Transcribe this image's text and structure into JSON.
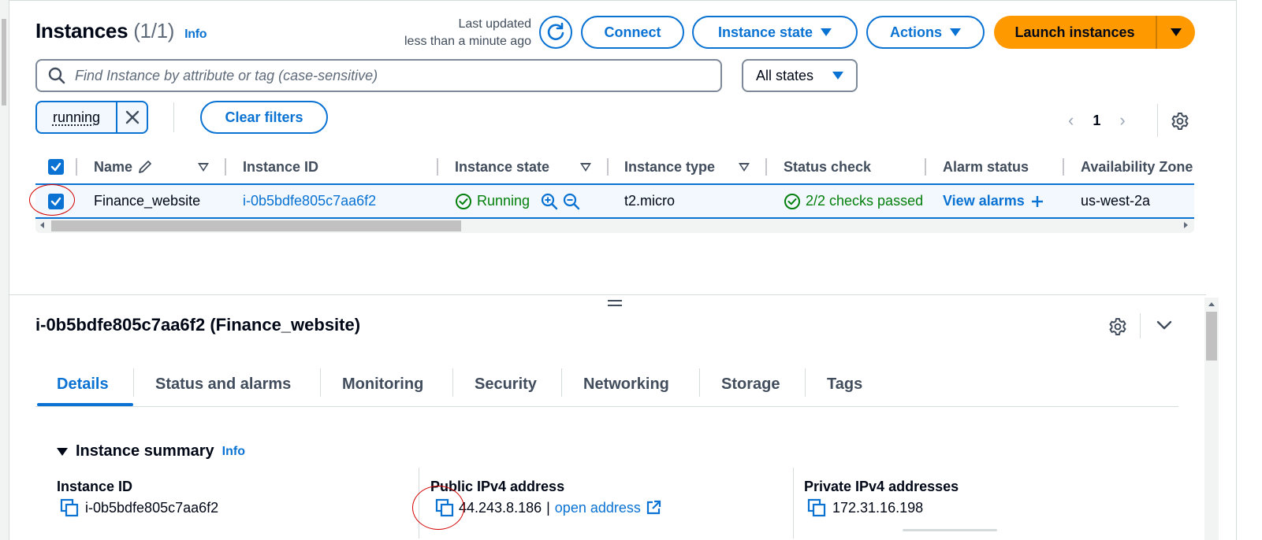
{
  "header": {
    "title": "Instances",
    "count": "(1/1)",
    "info": "Info",
    "last_updated_line1": "Last updated",
    "last_updated_line2": "less than a minute ago",
    "connect": "Connect",
    "instance_state": "Instance state",
    "actions": "Actions",
    "launch": "Launch instances"
  },
  "search": {
    "placeholder": "Find Instance by attribute or tag (case-sensitive)",
    "state_filter": "All states"
  },
  "filters": {
    "token": "running",
    "clear": "Clear filters"
  },
  "pagination": {
    "page": "1"
  },
  "table": {
    "columns": [
      "Name",
      "Instance ID",
      "Instance state",
      "Instance type",
      "Status check",
      "Alarm status",
      "Availability Zone"
    ],
    "row": {
      "name": "Finance_website",
      "instance_id": "i-0b5bdfe805c7aa6f2",
      "state": "Running",
      "type": "t2.micro",
      "status_check": "2/2 checks passed",
      "alarm": "View alarms",
      "az": "us-west-2a"
    }
  },
  "details": {
    "title": "i-0b5bdfe805c7aa6f2 (Finance_website)",
    "tabs": [
      "Details",
      "Status and alarms",
      "Monitoring",
      "Security",
      "Networking",
      "Storage",
      "Tags"
    ],
    "summary_title": "Instance summary",
    "summary_info": "Info",
    "fields": {
      "instance_id_label": "Instance ID",
      "instance_id_value": "i-0b5bdfe805c7aa6f2",
      "public_ip_label": "Public IPv4 address",
      "public_ip_value": "44.243.8.186",
      "public_ip_sep": "|",
      "open_address": "open address",
      "private_ip_label": "Private IPv4 addresses",
      "private_ip_value": "172.31.16.198"
    }
  },
  "colors": {
    "accent": "#0972d3",
    "launch": "#ff9900",
    "success": "#037f0c",
    "annotation": "#d40000"
  }
}
